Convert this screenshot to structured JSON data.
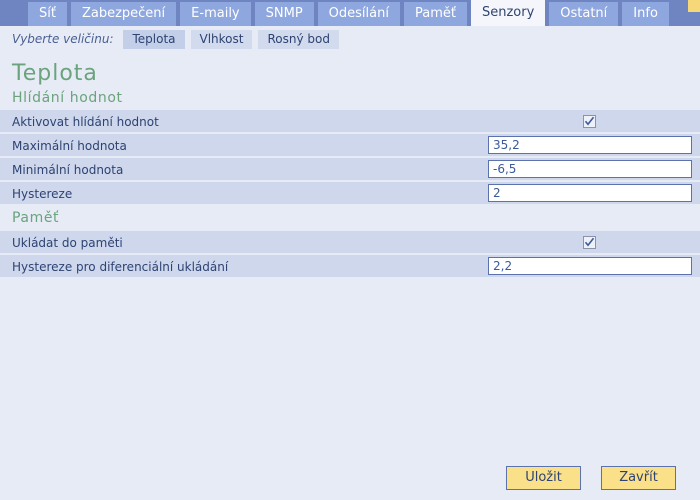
{
  "tabbar": {
    "tabs": [
      {
        "label": "Síť",
        "active": false
      },
      {
        "label": "Zabezpečení",
        "active": false
      },
      {
        "label": "E-maily",
        "active": false
      },
      {
        "label": "SNMP",
        "active": false
      },
      {
        "label": "Odesílání",
        "active": false
      },
      {
        "label": "Paměť",
        "active": false
      },
      {
        "label": "Senzory",
        "active": true
      },
      {
        "label": "Ostatní",
        "active": false
      },
      {
        "label": "Info",
        "active": false
      }
    ],
    "corner_color": "#f7d878",
    "bar_color": "#6e85c2",
    "tab_color": "#8ea7de",
    "active_tab_color": "#f4f6fb"
  },
  "subbar": {
    "label": "Vyberte veličinu:",
    "items": [
      {
        "label": "Teplota",
        "active": true
      },
      {
        "label": "Vlhkost",
        "active": false
      },
      {
        "label": "Rosný bod",
        "active": false
      }
    ]
  },
  "page": {
    "title": "Teplota",
    "heading_color": "#6aa37c"
  },
  "sections": [
    {
      "heading": "Hlídání hodnot",
      "rows": [
        {
          "label": "Aktivovat hlídání hodnot",
          "control": "checkbox",
          "checked": true
        },
        {
          "label": "Maximální hodnota",
          "control": "input",
          "value": "35,2"
        },
        {
          "label": "Minimální hodnota",
          "control": "input",
          "value": "-6,5"
        },
        {
          "label": "Hystereze",
          "control": "input",
          "value": "2"
        }
      ]
    },
    {
      "heading": "Paměť",
      "rows": [
        {
          "label": "Ukládat do paměti",
          "control": "checkbox",
          "checked": true
        },
        {
          "label": "Hystereze pro diferenciální ukládání",
          "control": "input",
          "value": "2,2"
        }
      ]
    }
  ],
  "footer": {
    "save_label": "Uložit",
    "close_label": "Zavřít",
    "button_color": "#fbe08a"
  }
}
